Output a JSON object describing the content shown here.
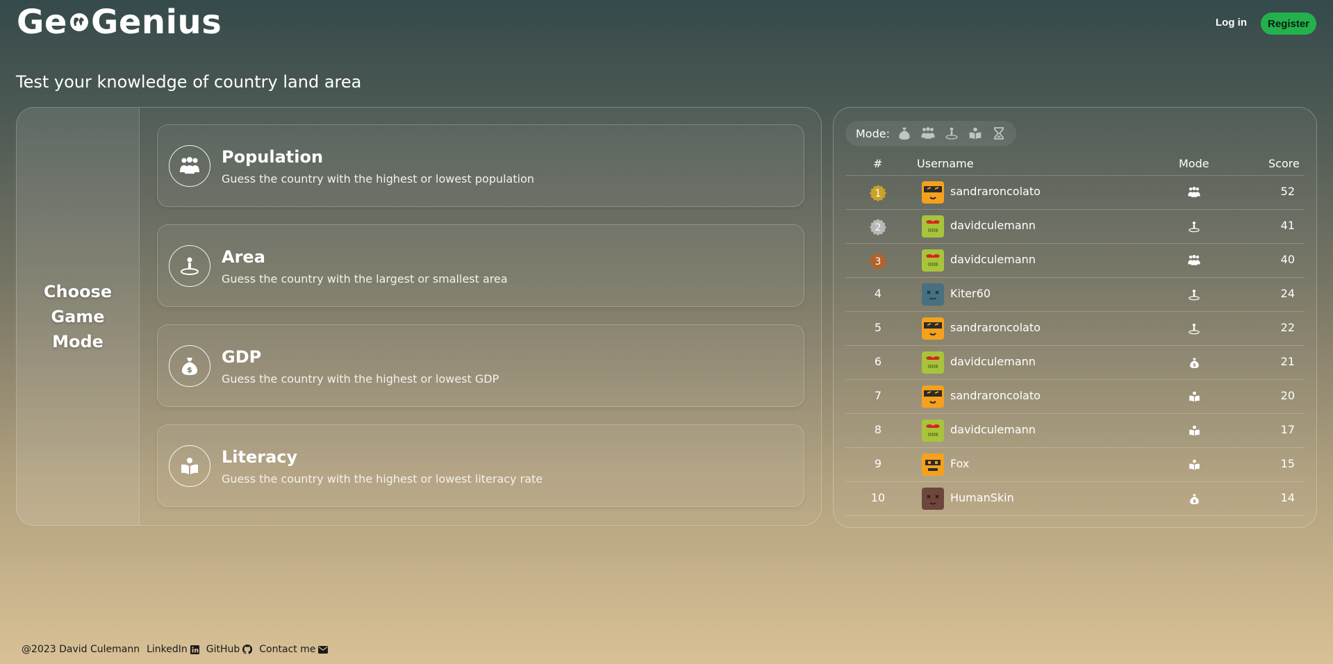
{
  "header": {
    "logo_text": "GeoGenius",
    "login_label": "Log in",
    "register_label": "Register"
  },
  "tagline": "Test your knowledge of country land area",
  "choose_panel": {
    "title": "Choose Game Mode"
  },
  "modes": [
    {
      "title": "Population",
      "description": "Guess the country with the highest or lowest population",
      "icon": "people-icon"
    },
    {
      "title": "Area",
      "description": "Guess the country with the largest or smallest area",
      "icon": "map-pin-icon"
    },
    {
      "title": "GDP",
      "description": "Guess the country with the highest or lowest GDP",
      "icon": "money-bag-icon"
    },
    {
      "title": "Literacy",
      "description": "Guess the country with the highest or lowest literacy rate",
      "icon": "book-reader-icon"
    }
  ],
  "leaderboard": {
    "filter_label": "Mode:",
    "filter_icons": [
      "money-bag-icon",
      "people-icon",
      "map-pin-icon",
      "book-reader-icon",
      "hourglass-icon"
    ],
    "columns": {
      "rank": "#",
      "username": "Username",
      "mode": "Mode",
      "score": "Score"
    },
    "medal_colors": {
      "gold": "#c9a227",
      "silver": "#b8b8b8",
      "bronze": "#b5622a"
    },
    "rows": [
      {
        "rank": "1",
        "username": "sandraroncolato",
        "mode_icon": "people-icon",
        "score": "52",
        "avatar": "orange-masked"
      },
      {
        "rank": "2",
        "username": "davidculemann",
        "mode_icon": "map-pin-icon",
        "score": "41",
        "avatar": "green-robot"
      },
      {
        "rank": "3",
        "username": "davidculemann",
        "mode_icon": "people-icon",
        "score": "40",
        "avatar": "green-robot"
      },
      {
        "rank": "4",
        "username": "Kiter60",
        "mode_icon": "map-pin-icon",
        "score": "24",
        "avatar": "blue-x"
      },
      {
        "rank": "5",
        "username": "sandraroncolato",
        "mode_icon": "map-pin-icon",
        "score": "22",
        "avatar": "orange-masked"
      },
      {
        "rank": "6",
        "username": "davidculemann",
        "mode_icon": "money-bag-icon",
        "score": "21",
        "avatar": "green-robot"
      },
      {
        "rank": "7",
        "username": "sandraroncolato",
        "mode_icon": "book-reader-icon",
        "score": "20",
        "avatar": "orange-masked"
      },
      {
        "rank": "8",
        "username": "davidculemann",
        "mode_icon": "book-reader-icon",
        "score": "17",
        "avatar": "green-robot"
      },
      {
        "rank": "9",
        "username": "Fox",
        "mode_icon": "book-reader-icon",
        "score": "15",
        "avatar": "orange-robot"
      },
      {
        "rank": "10",
        "username": "HumanSkin",
        "mode_icon": "money-bag-icon",
        "score": "14",
        "avatar": "brown-x"
      }
    ]
  },
  "footer": {
    "copyright": "@2023 David Culemann",
    "linkedin": "LinkedIn",
    "github": "GitHub",
    "contact": "Contact me"
  }
}
